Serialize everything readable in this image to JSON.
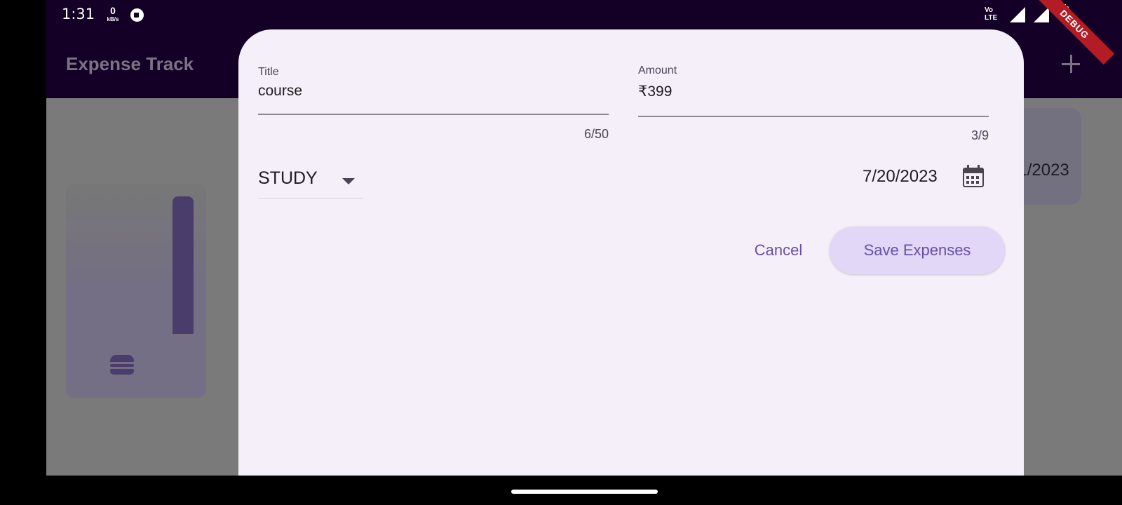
{
  "status_bar": {
    "time": "1:31",
    "net_speed_value": "0",
    "net_speed_unit": "kB/s",
    "network_label_top": "Vo",
    "network_label_bottom": "LTE",
    "debug_banner": "DEBUG"
  },
  "app_bar": {
    "title": "Expense Track",
    "add_icon": "plus-icon"
  },
  "background": {
    "visible_date": "7/21/2023",
    "category_icon": "burger-icon"
  },
  "form": {
    "title_label": "Title",
    "title_value": "course",
    "title_counter": "6/50",
    "amount_label": "Amount",
    "amount_value": "₹399",
    "amount_counter": "3/9",
    "category_value": "STUDY",
    "date_value": "7/20/2023",
    "cancel_label": "Cancel",
    "save_label": "Save Expenses"
  },
  "colors": {
    "status_bar_bg": "#140026",
    "sheet_bg": "#f5eff9",
    "accent": "#6750a4",
    "save_button_bg": "#e2d7f7",
    "debug_banner": "#b31b25"
  }
}
